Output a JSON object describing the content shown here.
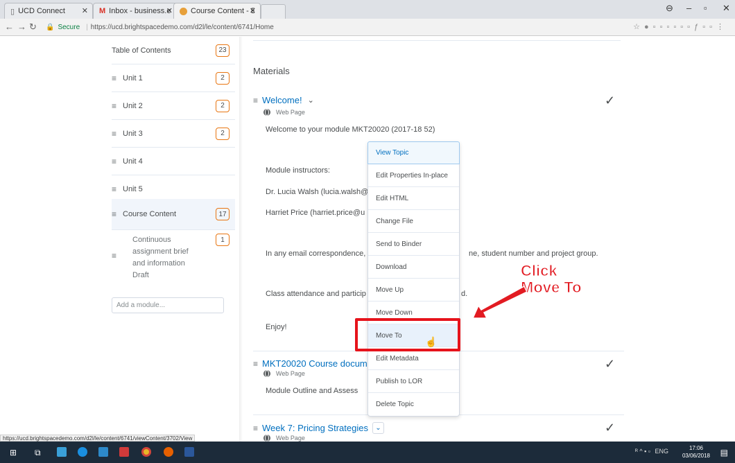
{
  "browser": {
    "tabs": [
      {
        "label": "UCD Connect",
        "active": false
      },
      {
        "label": "Inbox - business.elearni",
        "active": false
      },
      {
        "label": "Course Content - EdTech",
        "active": true
      }
    ],
    "url_secure_label": "Secure",
    "url": "https://ucd.brightspacedemo.com/d2l/le/content/6741/Home",
    "status_url": "https://ucd.brightspacedemo.com/d2l/le/content/6741/viewContent/3702/View"
  },
  "sidebar": {
    "toc_label": "Table of Contents",
    "toc_count": "23",
    "units": [
      {
        "label": "Unit 1",
        "count": "2"
      },
      {
        "label": "Unit 2",
        "count": "2"
      },
      {
        "label": "Unit 3",
        "count": "2"
      },
      {
        "label": "Unit 4",
        "count": ""
      },
      {
        "label": "Unit 5",
        "count": ""
      },
      {
        "label": "Course Content",
        "count": "17"
      }
    ],
    "sub_item": {
      "label": "Continuous assignment brief and information Draft",
      "count": "1"
    },
    "add_module_placeholder": "Add a module..."
  },
  "main": {
    "section_title": "Materials",
    "topic1": {
      "title": "Welcome!",
      "type": "Web Page"
    },
    "lines": [
      "Welcome to your module MKT20020 (2017-18 52)",
      "Module instructors:",
      "Dr. Lucia Walsh (lucia.walsh@",
      "Harriet Price (harriet.price@u",
      "In any email correspondence,",
      "ne, student number and project group.",
      "Class attendance and particip",
      "d.",
      "Enjoy!"
    ],
    "topic2": {
      "title": "MKT20020 Course docume",
      "type": "Web Page",
      "desc": "Module Outline and Assess"
    },
    "topic3": {
      "title": "Week 7: Pricing Strategies",
      "type": "Web Page"
    }
  },
  "context_menu": {
    "items": [
      "View Topic",
      "Edit Properties In-place",
      "Edit HTML",
      "Change File",
      "Send to Binder",
      "Download",
      "Move Up",
      "Move Down",
      "Move To",
      "Edit Metadata",
      "Publish to LOR",
      "Delete Topic"
    ]
  },
  "annotation": {
    "line1": "Click",
    "line2": "Move To",
    "color": "#e21b22"
  },
  "taskbar": {
    "lang": "ENG",
    "time": "17:06",
    "date": "03/06/2018"
  }
}
